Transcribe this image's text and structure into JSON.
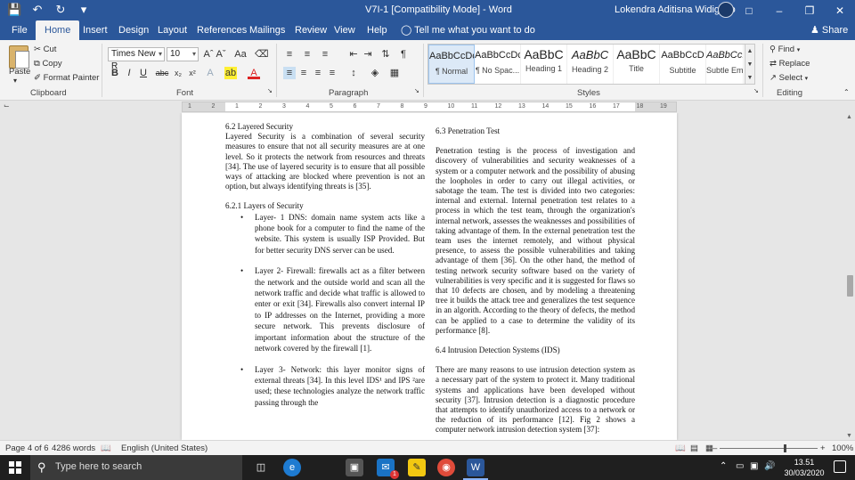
{
  "window": {
    "title": "V7I-1 [Compatibility Mode]  -  Word",
    "user_name": "Lokendra Aditisna Widigdyo",
    "qat": [
      "save-icon",
      "undo-icon",
      "redo-icon",
      "customize-icon"
    ],
    "controls": [
      "ribbon-display-icon",
      "minimize-icon",
      "restore-icon",
      "close-icon"
    ]
  },
  "tabs": [
    "File",
    "Home",
    "Insert",
    "Design",
    "Layout",
    "References",
    "Mailings",
    "Review",
    "View",
    "Help"
  ],
  "active_tab": "Home",
  "tell_me": "Tell me what you want to do",
  "share": "Share",
  "ribbon": {
    "clipboard": {
      "paste": "Paste",
      "cut": "Cut",
      "copy": "Copy",
      "format_painter": "Format Painter",
      "label": "Clipboard"
    },
    "font": {
      "family": "Times New R",
      "size": "10",
      "label": "Font"
    },
    "paragraph": {
      "label": "Paragraph"
    },
    "styles": {
      "items": [
        {
          "preview": "AaBbCcDc",
          "name": "¶ Normal"
        },
        {
          "preview": "AaBbCcDc",
          "name": "¶ No Spac..."
        },
        {
          "preview": "AaBbC",
          "name": "Heading 1"
        },
        {
          "preview": "AaBbC",
          "name": "Heading 2"
        },
        {
          "preview": "AaBbC",
          "name": "Title"
        },
        {
          "preview": "AaBbCcD",
          "name": "Subtitle"
        },
        {
          "preview": "AaBbCcDc",
          "name": "Subtle Em..."
        }
      ],
      "label": "Styles"
    },
    "editing": {
      "find": "Find",
      "replace": "Replace",
      "select": "Select",
      "label": "Editing"
    }
  },
  "ruler_numbers": [
    "1",
    "2",
    "1",
    "2",
    "3",
    "4",
    "5",
    "6",
    "7",
    "8",
    "9",
    "10",
    "11",
    "12",
    "13",
    "14",
    "15",
    "16",
    "17",
    "18",
    "19"
  ],
  "document": {
    "left": {
      "h1": "6.2 Layered Security",
      "p1": "Layered Security is a combination of several security measures to ensure that not all security measures are at one level. So it protects the network from resources and threats [34]. The use of layered security is to ensure that all possible ways of attacking are blocked where prevention is not an option, but always identifying threats is [35].",
      "h2": "6.2.1 Layers of Security",
      "b1": "Layer- 1 DNS: domain name system acts like a phone book for a computer to find the name of the website. This system is usually ISP Provided. But for better security DNS server can be used.",
      "b2": "Layer 2- Firewall: firewalls act as a filter between the network and the outside world and scan all the network traffic and decide what traffic is allowed to enter or exit [34]. Firewalls also convert internal IP to IP addresses on the Internet, providing a more secure network. This prevents disclosure of important information about the structure of the network covered by the firewall [1].",
      "b3": "Layer 3- Network: this layer monitor signs of external threats [34]. In this level IDS¹ and IPS ²are used; these technologies analyze the network traffic passing through the"
    },
    "right": {
      "h1": "6.3 Penetration Test",
      "p1": "Penetration testing is the process of investigation and discovery of vulnerabilities and security weaknesses of a system or a computer network and the possibility of abusing the loopholes in order to carry out illegal activities, or sabotage the team. The test is divided into two categories: internal and external. Internal penetration test relates to a process in which the test team, through the organization's internal network, assesses the weaknesses and possibilities of taking advantage of them. In the external penetration test the team uses the internet remotely, and without physical presence, to assess the possible vulnerabilities and taking advantage of them [36]. On the other hand, the method of testing network security software based on the variety of vulnerabilities is very specific and it is suggested for flaws so that 10 defects are chosen, and by modeling a threatening tree it builds the attack tree and generalizes the test sequence in an algorith. According to the theory of defects, the method can be applied to a case to determine the validity of its performance [8].",
      "h2": "6.4 Intrusion Detection Systems (IDS)",
      "p2": "There are many reasons to use intrusion detection system as a necessary part of the system to protect it. Many traditional systems and applications have been developed without security [37]. Intrusion detection is a diagnostic procedure that attempts to identify unauthorized access to a network or the reduction of its performance [12]. Fig 2 shows a computer network intrusion detection system [37]:"
    }
  },
  "status": {
    "page": "Page 4 of 6",
    "words": "4286 words",
    "language": "English (United States)",
    "zoom": "100%",
    "zoom_level": 1.0
  },
  "taskbar": {
    "search_placeholder": "Type here to search",
    "apps": [
      "task-view-icon",
      "edge-icon",
      "store-icon",
      "mail-icon",
      "sticky-notes-icon",
      "chrome-icon",
      "word-icon"
    ],
    "mail_badge": "1",
    "time": "13.51",
    "date": "30/03/2020"
  }
}
